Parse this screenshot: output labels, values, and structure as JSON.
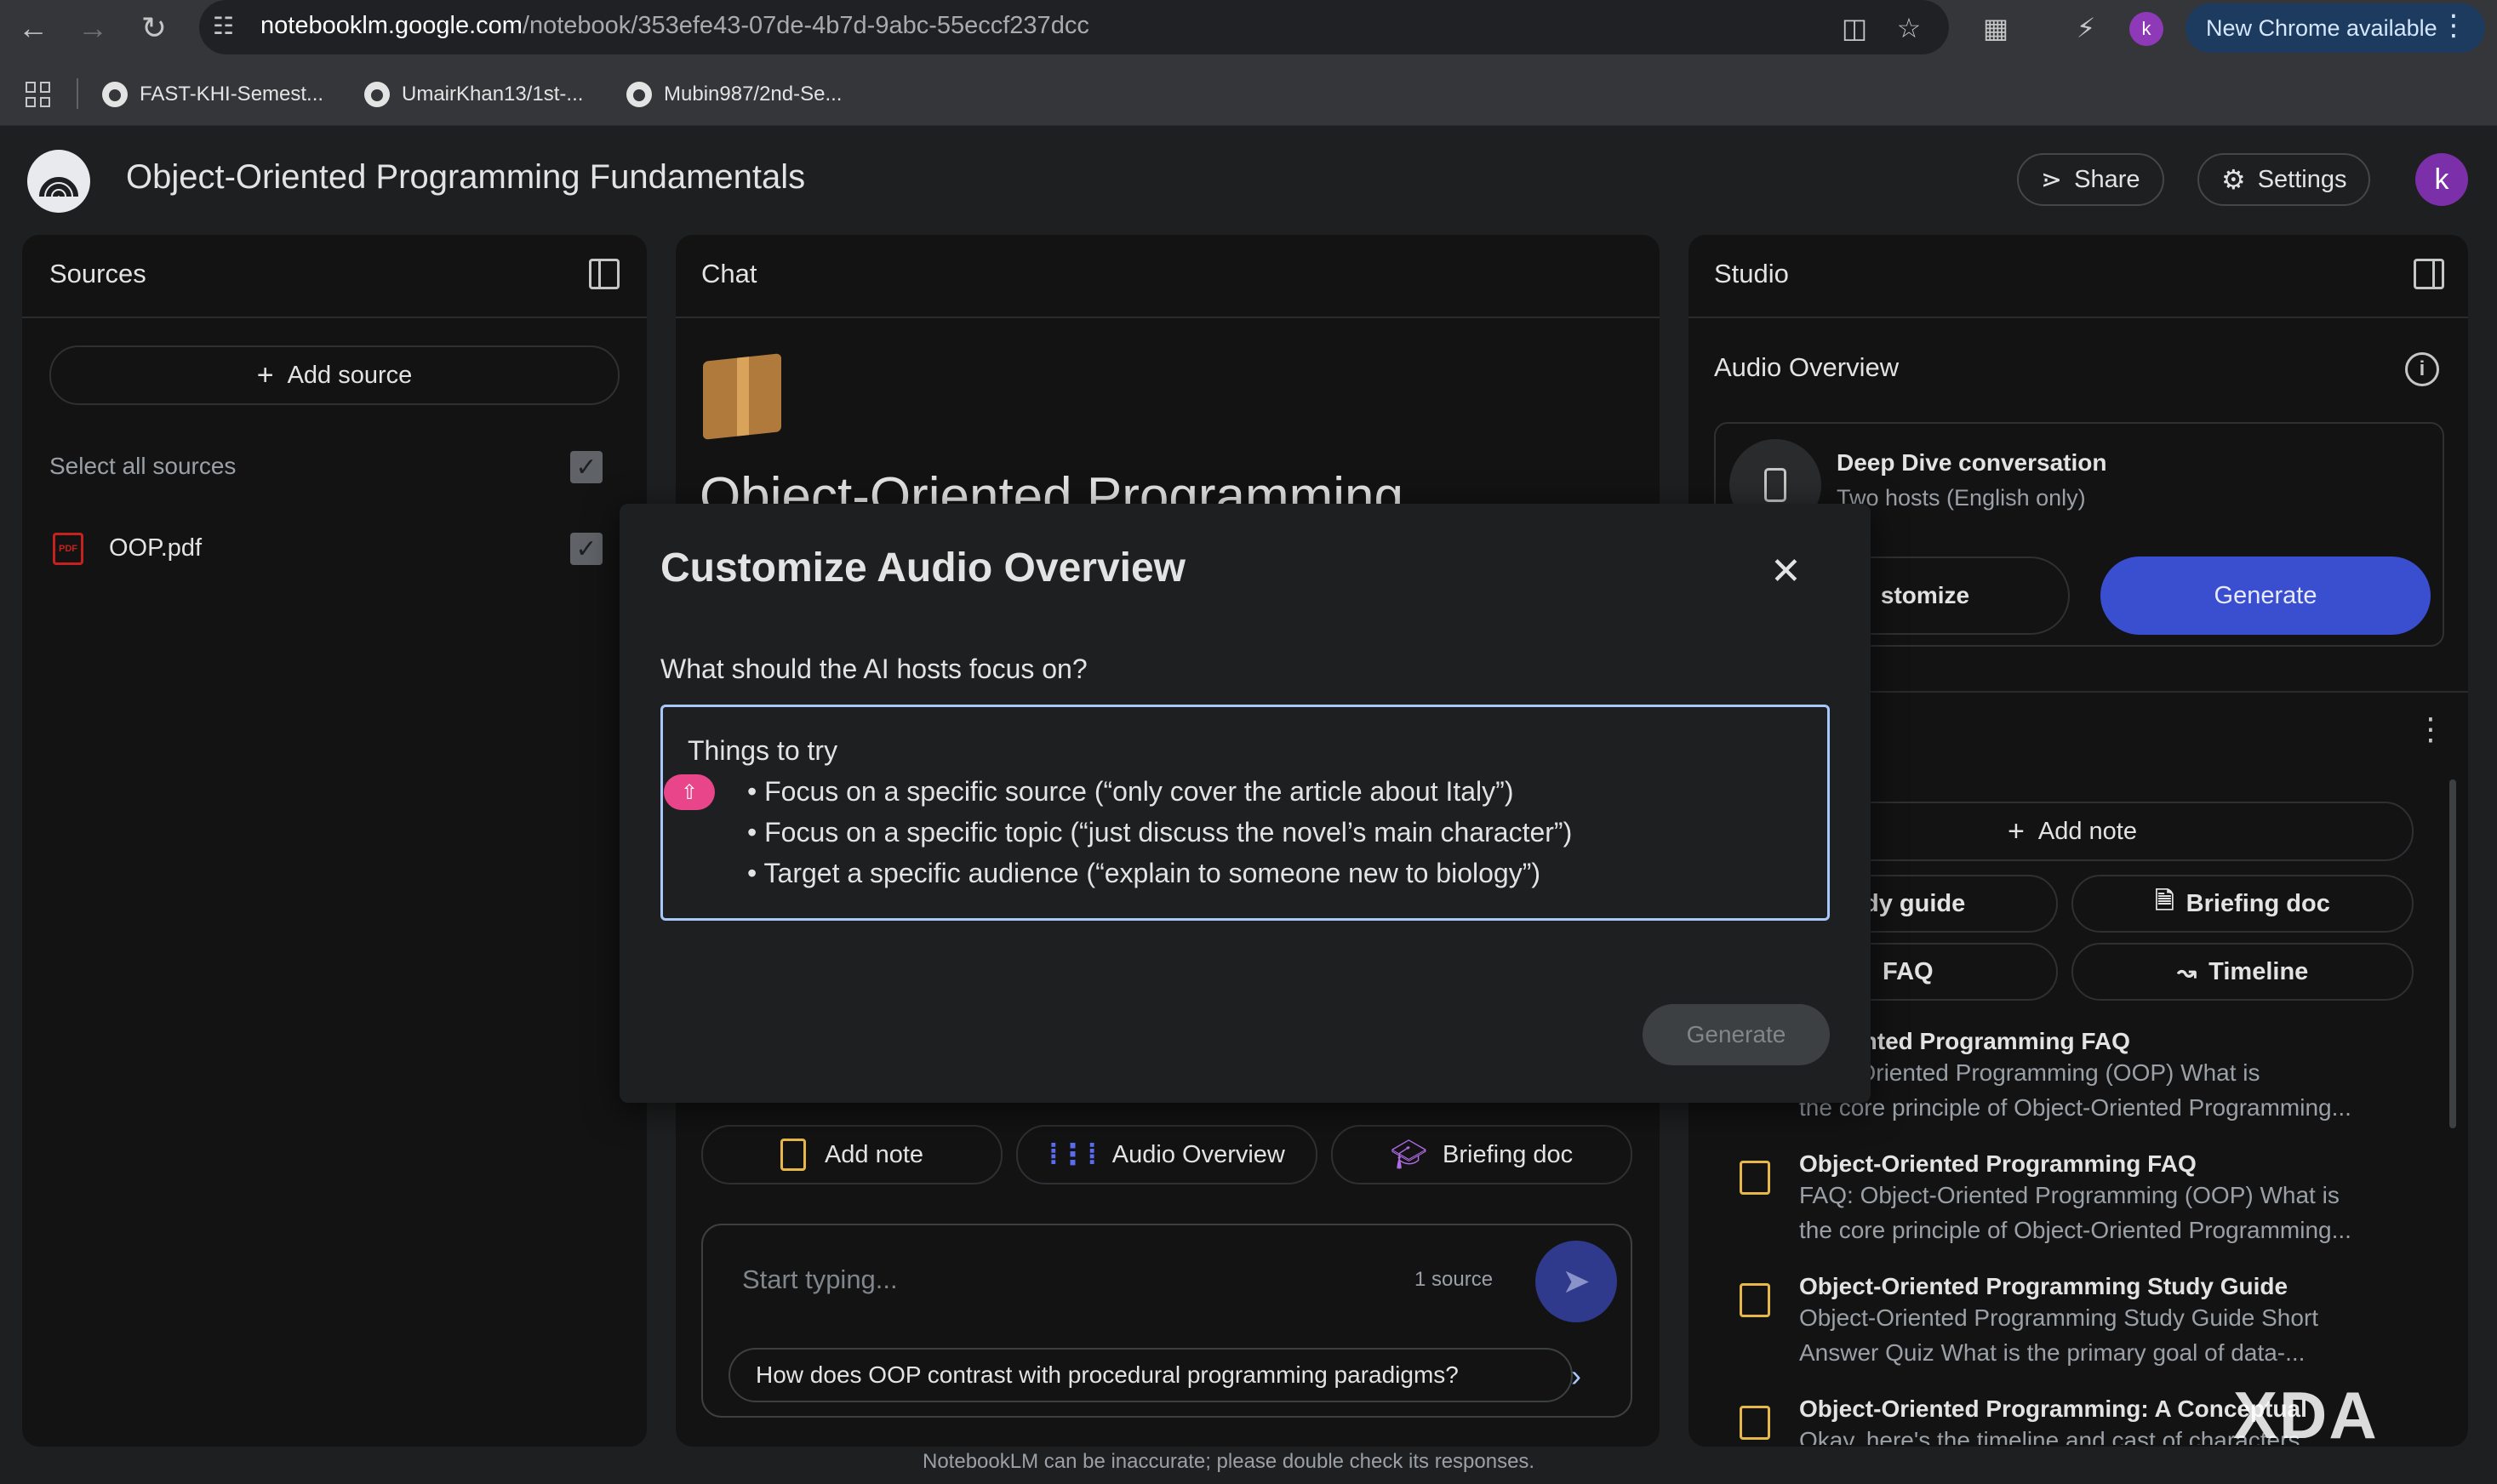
{
  "browser": {
    "url_host": "notebooklm.google.com",
    "url_path": "/notebook/353efe43-07de-4b7d-9abc-55eccf237dcc",
    "profile_initial": "k",
    "new_chrome_label": "New Chrome available",
    "bookmarks": [
      "FAST-KHI-Semest...",
      "UmairKhan13/1st-...",
      "Mubin987/2nd-Se..."
    ]
  },
  "app": {
    "title": "Object-Oriented Programming Fundamentals",
    "share_label": "Share",
    "settings_label": "Settings",
    "avatar_initial": "k"
  },
  "sources": {
    "heading": "Sources",
    "add_source_label": "Add source",
    "select_all_label": "Select all sources",
    "items": [
      {
        "icon_text": "PDF",
        "name": "OOP.pdf"
      }
    ]
  },
  "chat": {
    "heading": "Chat",
    "notebook_title_partial": "Object-Oriented Programming",
    "actions": [
      "Add note",
      "Audio Overview",
      "Briefing doc"
    ],
    "input_placeholder": "Start typing...",
    "source_count": "1 source",
    "suggestion": "How does OOP contrast with procedural programming paradigms?",
    "disclaimer": "NotebookLM can be inaccurate; please double check its responses."
  },
  "studio": {
    "heading": "Studio",
    "audio_overview_label": "Audio Overview",
    "deep_dive_title": "Deep Dive conversation",
    "deep_dive_subtitle": "Two hosts (English only)",
    "customize_label": "stomize",
    "generate_label": "Generate",
    "add_note_label": "Add note",
    "study_guide_label": "dy guide",
    "briefing_doc_label": "Briefing doc",
    "faq_label": "FAQ",
    "timeline_label": "Timeline",
    "notes": [
      {
        "title": "t-Oriented Programming FAQ",
        "body1": "bject-Oriented Programming (OOP) What is",
        "body2": "the core principle of Object-Oriented Programming..."
      },
      {
        "title": "Object-Oriented Programming FAQ",
        "body1": "FAQ: Object-Oriented Programming (OOP) What is",
        "body2": "the core principle of Object-Oriented Programming..."
      },
      {
        "title": "Object-Oriented Programming Study Guide",
        "body1": "Object-Oriented Programming Study Guide Short",
        "body2": "Answer Quiz What is the primary goal of data-..."
      },
      {
        "title": "Object-Oriented Programming: A Conceptual",
        "body1": "Okay, here's the timeline and cast of characters",
        "body2": ""
      }
    ]
  },
  "modal": {
    "title": "Customize Audio Overview",
    "question": "What should the AI hosts focus on?",
    "tips_heading": "Things to try",
    "tips": [
      "• Focus on a specific source (“only cover the article about Italy”)",
      "• Focus on a specific topic (“just discuss the novel’s main character”)",
      "• Target a specific audience (“explain to someone new to biology”)"
    ],
    "generate_label": "Generate"
  },
  "watermark": "XDA",
  "colors": {
    "accent": "#3a4fcf",
    "focus_border": "#a8c7fa",
    "note_icon": "#e8b74a",
    "badge_pink": "#e8458b"
  }
}
